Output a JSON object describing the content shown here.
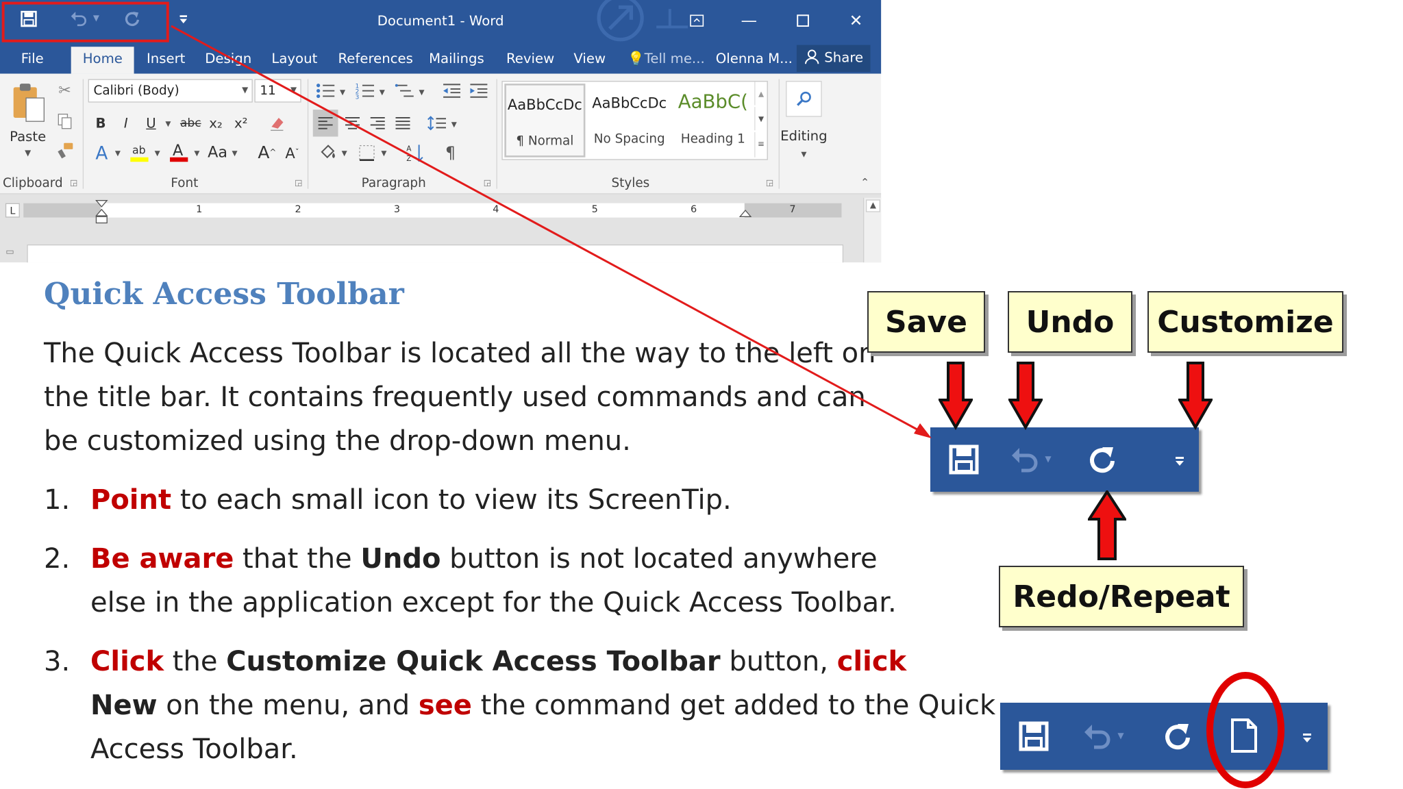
{
  "word": {
    "window_title": "Document1 - Word",
    "tabs": [
      "File",
      "Home",
      "Insert",
      "Design",
      "Layout",
      "References",
      "Mailings",
      "Review",
      "View"
    ],
    "tell_me": "Tell me...",
    "user": "Olenna M...",
    "share": "Share",
    "paste_label": "Paste",
    "font_name": "Calibri (Body)",
    "font_size": "11",
    "styles": [
      {
        "sample": "AaBbCcDc",
        "name": "¶ Normal"
      },
      {
        "sample": "AaBbCcDc",
        "name": "No Spacing"
      },
      {
        "sample": "AaBbC(",
        "name": "Heading 1"
      }
    ],
    "editing_label": "Editing",
    "group_labels": [
      "Clipboard",
      "Font",
      "Paragraph",
      "Styles"
    ],
    "format_buttons": [
      "B",
      "I",
      "U",
      "abc",
      "x₂",
      "x²",
      "Aa",
      "¶"
    ],
    "ruler_numbers": [
      "1",
      "2",
      "3",
      "4",
      "5",
      "6",
      "7"
    ],
    "ruler_tab": "L"
  },
  "lesson": {
    "heading": "Quick Access Toolbar",
    "intro": [
      "The Quick Access Toolbar is located all the way to the left on",
      "the title bar.  It contains frequently used commands and can",
      "be customized using the drop-down menu."
    ],
    "items": [
      {
        "number": "1.",
        "lines": [
          [
            {
              "t": "Point",
              "s": "red"
            },
            {
              "t": " to each small icon to view its ScreenTip.",
              "s": ""
            }
          ]
        ]
      },
      {
        "number": "2.",
        "lines": [
          [
            {
              "t": "Be aware",
              "s": "red"
            },
            {
              "t": " that the ",
              "s": ""
            },
            {
              "t": "Undo",
              "s": "b"
            },
            {
              "t": " button is not located anywhere",
              "s": ""
            }
          ],
          [
            {
              "t": "else in the application except for the Quick Access Toolbar.",
              "s": ""
            }
          ]
        ]
      },
      {
        "number": "3.",
        "lines": [
          [
            {
              "t": "Click",
              "s": "red"
            },
            {
              "t": " the ",
              "s": ""
            },
            {
              "t": "Customize Quick Access Toolbar",
              "s": "b"
            },
            {
              "t": " button, ",
              "s": ""
            },
            {
              "t": "click",
              "s": "red"
            }
          ],
          [
            {
              "t": "New",
              "s": "b"
            },
            {
              "t": " on the menu, and ",
              "s": ""
            },
            {
              "t": "see",
              "s": "red"
            },
            {
              "t": " the command get added to the Quick",
              "s": ""
            }
          ],
          [
            {
              "t": "Access Toolbar.",
              "s": ""
            }
          ]
        ]
      }
    ]
  },
  "callouts": {
    "save": "Save",
    "undo": "Undo",
    "customize": "Customize",
    "redo": "Redo/Repeat"
  },
  "colors": {
    "word_blue": "#2b579a",
    "callout_fill": "#ffffcc",
    "annotation_red": "#e21b1b",
    "heading_blue": "#4f81bd",
    "emphasis_red": "#c00000"
  }
}
